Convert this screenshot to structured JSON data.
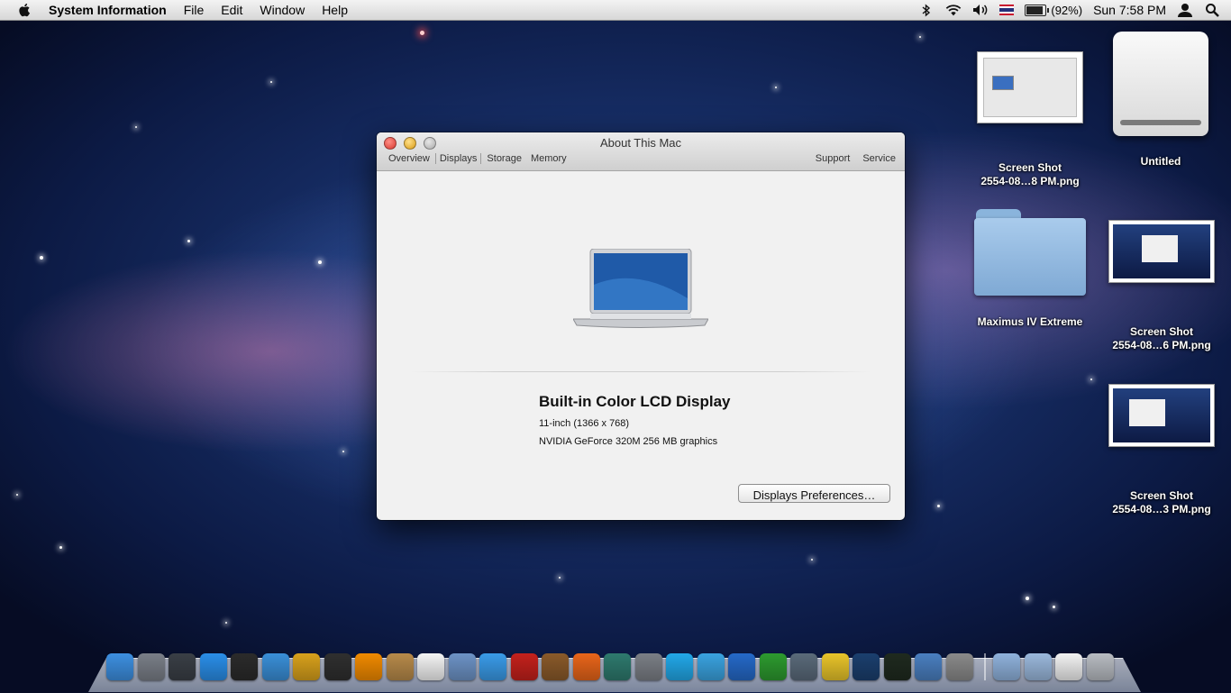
{
  "menubar": {
    "app_name": "System Information",
    "menus": [
      "File",
      "Edit",
      "Window",
      "Help"
    ],
    "battery_percent": "(92%)",
    "battery_level": 0.92,
    "clock": "Sun 7:58 PM"
  },
  "window": {
    "title": "About This Mac",
    "tabs": [
      "Overview",
      "Displays",
      "Storage",
      "Memory"
    ],
    "active_tab": "Displays",
    "right_tabs": [
      "Support",
      "Service"
    ],
    "display_title": "Built-in Color LCD Display",
    "display_size": "11-inch (1366 x 768)",
    "display_graphics": "NVIDIA GeForce 320M 256 MB graphics",
    "preferences_button": "Displays Preferences…"
  },
  "desktop": {
    "icons": [
      {
        "line1": "Screen Shot",
        "line2": "2554-08…8 PM.png"
      },
      {
        "line1": "Untitled",
        "line2": ""
      },
      {
        "line1": "Maximus IV Extreme",
        "line2": ""
      },
      {
        "line1": "Screen Shot",
        "line2": "2554-08…6 PM.png"
      },
      {
        "line1": "Screen Shot",
        "line2": "2554-08…3 PM.png"
      }
    ]
  },
  "dock": {
    "apps": [
      {
        "name": "finder-icon",
        "color": "#3d8fe0"
      },
      {
        "name": "launchpad-icon",
        "color": "#7a7f88"
      },
      {
        "name": "mission-control-icon",
        "color": "#3a3f46"
      },
      {
        "name": "app-store-icon",
        "color": "#2a8ee8"
      },
      {
        "name": "dashboard-icon",
        "color": "#2b2b2b"
      },
      {
        "name": "safari-icon",
        "color": "#3a8fd8"
      },
      {
        "name": "pineapple-icon",
        "color": "#d8a11c"
      },
      {
        "name": "clapper-icon",
        "color": "#2f2f2f"
      },
      {
        "name": "vlc-icon",
        "color": "#f08a00"
      },
      {
        "name": "address-book-icon",
        "color": "#b78a4a"
      },
      {
        "name": "ical-icon",
        "color": "#f4f4f4"
      },
      {
        "name": "preview-icon",
        "color": "#6d93c6"
      },
      {
        "name": "itunes-icon",
        "color": "#3a9be8"
      },
      {
        "name": "photo-booth-icon",
        "color": "#c4211c"
      },
      {
        "name": "iphoto-icon",
        "color": "#8a5a2a"
      },
      {
        "name": "firefox-icon",
        "color": "#e8651a"
      },
      {
        "name": "time-machine-icon",
        "color": "#2e7a6e"
      },
      {
        "name": "system-preferences-icon",
        "color": "#7b7f86"
      },
      {
        "name": "skype-icon",
        "color": "#22a8e8"
      },
      {
        "name": "messenger-icon",
        "color": "#3aa3e0"
      },
      {
        "name": "word-icon",
        "color": "#2569c8"
      },
      {
        "name": "excel-icon",
        "color": "#2d9a2f"
      },
      {
        "name": "facetime-icon",
        "color": "#5a6a7a"
      },
      {
        "name": "stickies-icon",
        "color": "#e8c42a"
      },
      {
        "name": "photoshop-icon",
        "color": "#1b3f6e"
      },
      {
        "name": "activity-monitor-icon",
        "color": "#1f2a1f"
      },
      {
        "name": "xcode-icon",
        "color": "#4a7fc0"
      },
      {
        "name": "script-editor-icon",
        "color": "#8a8a8a"
      }
    ],
    "stacks": [
      {
        "name": "applications-stack-icon",
        "color": "#8fb2dc"
      },
      {
        "name": "documents-stack-icon",
        "color": "#9ab8dc"
      },
      {
        "name": "document-icon",
        "color": "#f2f2f2"
      },
      {
        "name": "trash-icon",
        "color": "#b8bcc2"
      }
    ]
  }
}
